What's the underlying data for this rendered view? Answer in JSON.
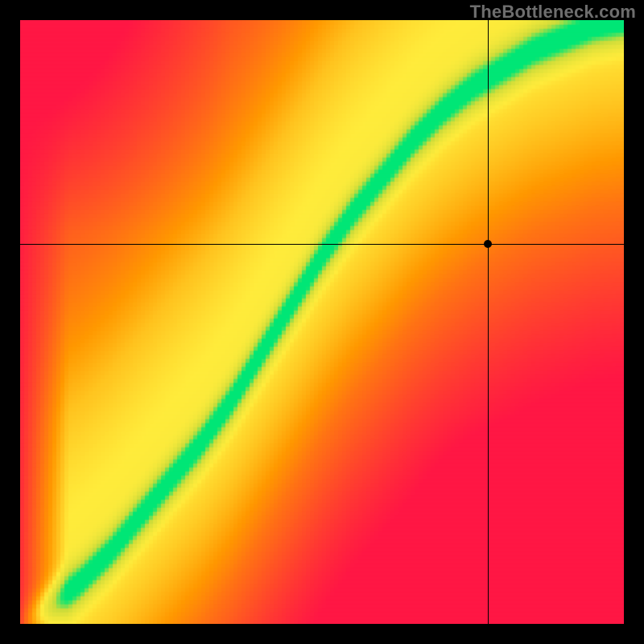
{
  "watermark": "TheBottleneck.com",
  "chart_data": {
    "type": "heatmap",
    "title": "",
    "xlabel": "",
    "ylabel": "",
    "xlim": [
      0,
      1
    ],
    "ylim": [
      0,
      1
    ],
    "grid": false,
    "legend": false,
    "crosshair": {
      "x": 0.775,
      "y": 0.63
    },
    "marker": {
      "x": 0.775,
      "y": 0.63
    },
    "ridge_control_points": [
      {
        "x": 0.0,
        "y": 0.0
      },
      {
        "x": 0.05,
        "y": 0.03
      },
      {
        "x": 0.1,
        "y": 0.07
      },
      {
        "x": 0.15,
        "y": 0.12
      },
      {
        "x": 0.2,
        "y": 0.18
      },
      {
        "x": 0.25,
        "y": 0.24
      },
      {
        "x": 0.3,
        "y": 0.3
      },
      {
        "x": 0.35,
        "y": 0.37
      },
      {
        "x": 0.4,
        "y": 0.45
      },
      {
        "x": 0.45,
        "y": 0.53
      },
      {
        "x": 0.5,
        "y": 0.61
      },
      {
        "x": 0.55,
        "y": 0.68
      },
      {
        "x": 0.6,
        "y": 0.74
      },
      {
        "x": 0.65,
        "y": 0.8
      },
      {
        "x": 0.7,
        "y": 0.85
      },
      {
        "x": 0.75,
        "y": 0.89
      },
      {
        "x": 0.8,
        "y": 0.92
      },
      {
        "x": 0.85,
        "y": 0.95
      },
      {
        "x": 0.9,
        "y": 0.97
      },
      {
        "x": 0.95,
        "y": 0.99
      },
      {
        "x": 1.0,
        "y": 1.0
      }
    ],
    "colormap_stops": [
      {
        "t": 0.0,
        "color": "#ff1744"
      },
      {
        "t": 0.35,
        "color": "#ff9800"
      },
      {
        "t": 0.55,
        "color": "#ffeb3b"
      },
      {
        "t": 0.8,
        "color": "#cddc39"
      },
      {
        "t": 1.0,
        "color": "#00e676"
      }
    ],
    "ridge_width_norm": 0.06,
    "pixel_resolution": 150
  }
}
